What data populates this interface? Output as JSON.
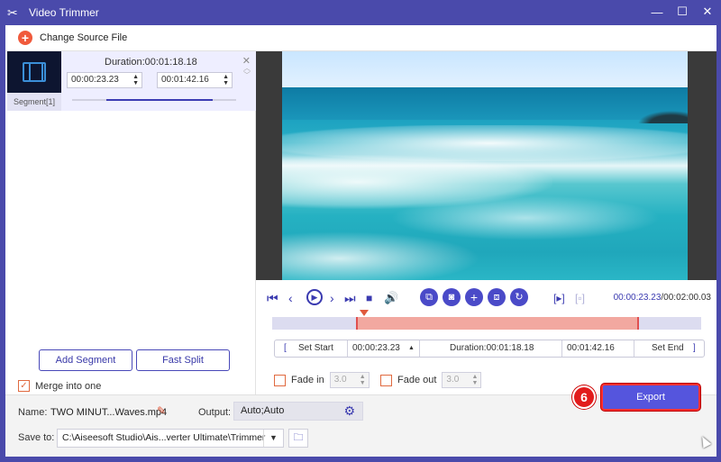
{
  "window": {
    "title": "Video Trimmer"
  },
  "source": {
    "change_label": "Change Source File"
  },
  "segment": {
    "label": "Segment[1]",
    "duration": "Duration:00:01:18.18",
    "start": "00:00:23.23",
    "end": "00:01:42.16",
    "progress": 0.65
  },
  "left_buttons": {
    "add_segment": "Add Segment",
    "fast_split": "Fast Split"
  },
  "merge": {
    "label": "Merge into one",
    "checked": true
  },
  "playback": {
    "current": "00:00:23.23",
    "total": "/00:02:00.03",
    "icons": [
      "skip-start-icon",
      "prev-frame-icon",
      "play-icon",
      "next-frame-icon",
      "skip-end-icon",
      "stop-icon",
      "volume-icon",
      "split-view-icon",
      "snapshot-icon",
      "add-icon",
      "copy-icon",
      "reset-icon",
      "preview-start-icon",
      "preview-end-icon"
    ]
  },
  "timeline": {
    "selection_start": 0.195,
    "selection_end": 0.855
  },
  "setrow": {
    "set_start": "Set Start",
    "start": "00:00:23.23",
    "duration": "Duration:00:01:18.18",
    "end": "00:01:42.16",
    "set_end": "Set End"
  },
  "fade": {
    "in_label": "Fade in",
    "in_value": "3.0",
    "out_label": "Fade out",
    "out_value": "3.0"
  },
  "bottom": {
    "name_label": "Name:",
    "name_value": "TWO MINUT...Waves.mp4",
    "output_label": "Output:",
    "output_value": "Auto;Auto",
    "save_label": "Save to:",
    "save_value": "C:\\Aiseesoft Studio\\Ais...verter Ultimate\\Trimmer",
    "export_label": "Export",
    "step_number": "6"
  },
  "colors": {
    "accent": "#4a4ac8",
    "title_bar": "#4a4aab",
    "highlight": "#e21b1b"
  }
}
